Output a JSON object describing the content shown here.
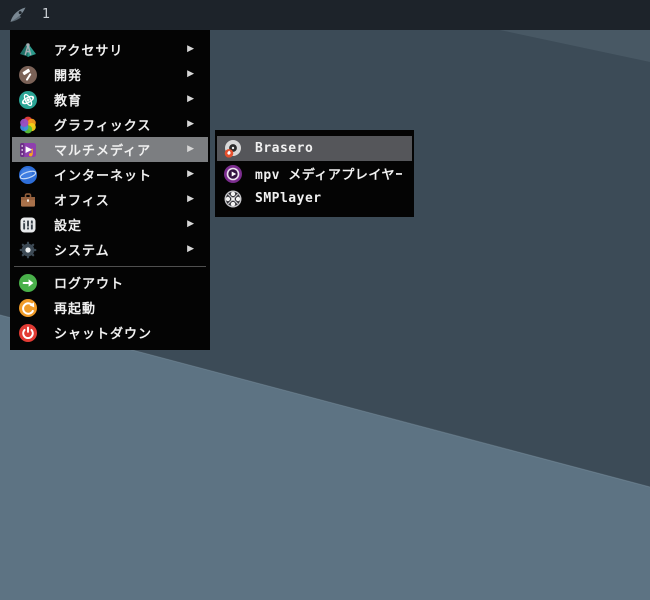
{
  "topbar": {
    "workspace": "1",
    "launcher_icon": "rocket-icon"
  },
  "menu": {
    "categories": [
      {
        "label": "アクセサリ",
        "icon": "accessories",
        "has_submenu": true,
        "selected": false
      },
      {
        "label": "開発",
        "icon": "development",
        "has_submenu": true,
        "selected": false
      },
      {
        "label": "教育",
        "icon": "education",
        "has_submenu": true,
        "selected": false
      },
      {
        "label": "グラフィックス",
        "icon": "graphics",
        "has_submenu": true,
        "selected": false
      },
      {
        "label": "マルチメディア",
        "icon": "multimedia",
        "has_submenu": true,
        "selected": true
      },
      {
        "label": "インターネット",
        "icon": "internet",
        "has_submenu": true,
        "selected": false
      },
      {
        "label": "オフィス",
        "icon": "office",
        "has_submenu": true,
        "selected": false
      },
      {
        "label": "設定",
        "icon": "settings",
        "has_submenu": true,
        "selected": false
      },
      {
        "label": "システム",
        "icon": "system",
        "has_submenu": true,
        "selected": false
      }
    ],
    "actions": [
      {
        "label": "ログアウト",
        "icon": "logout",
        "color": "#49b04a"
      },
      {
        "label": "再起動",
        "icon": "reboot",
        "color": "#f09b28"
      },
      {
        "label": "シャットダウン",
        "icon": "shutdown",
        "color": "#e23b34"
      }
    ]
  },
  "submenu": {
    "parent": "マルチメディア",
    "items": [
      {
        "label": "Brasero",
        "icon": "brasero",
        "selected": true
      },
      {
        "label": "mpv メディアプレイヤー",
        "icon": "mpv",
        "selected": false
      },
      {
        "label": "SMPlayer",
        "icon": "smplayer",
        "selected": false
      }
    ]
  },
  "colors": {
    "topbar_bg": "#1d232a",
    "menu_bg": "#040404",
    "highlight_main": "#7c7e81",
    "highlight_sub": "#55565a",
    "menu_text": "#f0f0f0",
    "desktop_upper": "#3c4b57",
    "desktop_lower": "#5d7383",
    "desktop_wedge": "#48586-4"
  }
}
